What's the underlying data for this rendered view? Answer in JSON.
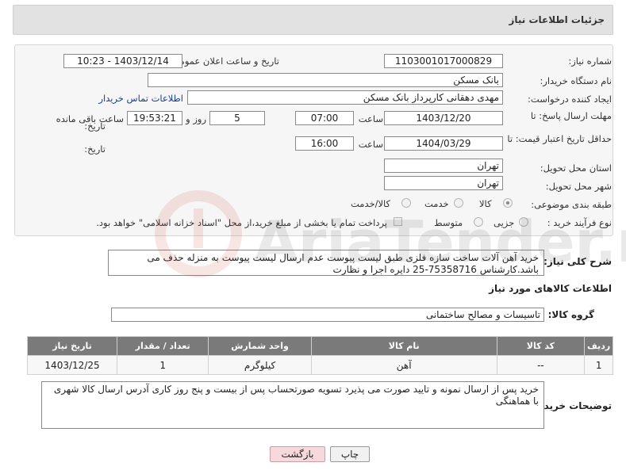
{
  "header": {
    "title": "جزئیات اطلاعات نیاز"
  },
  "form": {
    "need_number_label": "شماره نیاز:",
    "need_number": "1103001017000829",
    "announce_label": "تاریخ و ساعت اعلان عمومی:",
    "announce_value": "1403/12/14 - 10:23",
    "buyer_org_label": "نام دستگاه خریدار:",
    "buyer_org": "بانک مسکن",
    "creator_label": "ایجاد کننده درخواست:",
    "creator": "مهدی دهقانی کارپرداز بانک مسکن",
    "contact_link": "اطلاعات تماس خریدار",
    "deadline_label_1": "مهلت ارسال پاسخ: تا",
    "deadline_label_2": "تاریخ:",
    "deadline_date": "1403/12/20",
    "time_label": "ساعت",
    "deadline_time": "07:00",
    "days_value": "5",
    "days_label": "روز و",
    "remaining_time": "19:53:21",
    "remaining_label": "ساعت باقی مانده",
    "validity_label_1": "حداقل تاریخ اعتبار قیمت: تا",
    "validity_label_2": "تاریخ:",
    "validity_date": "1404/03/29",
    "validity_time_label": "ساعت",
    "validity_time": "16:00",
    "province_label": "استان محل تحویل:",
    "province": "تهران",
    "city_label": "شهر محل تحویل:",
    "city": "تهران",
    "category_label": "طبقه بندی موضوعی:",
    "category_options": [
      "کالا",
      "خدمت",
      "کالا/خدمت"
    ],
    "process_label": "نوع فرآیند خرید :",
    "process_options": [
      "جزیی",
      "متوسط"
    ],
    "payment_note": "پرداخت تمام یا بخشی از مبلغ خرید،از محل \"اسناد خزانه اسلامی\" خواهد بود."
  },
  "description": {
    "label": "شرح کلی نیاز:",
    "text": "خرید آهن آلات ساخت سازه فلزی طبق لیست پیوست عدم ارسال لیست پیوست به منزله حذف می باشد.کارشناس 75358716-25 دایره اجرا و نظارت"
  },
  "goods": {
    "section_title": "اطلاعات کالاهای مورد نیاز",
    "group_label": "گروه کالا:",
    "group_value": "تاسیسات و مصالح ساختمانی",
    "columns": [
      "ردیف",
      "کد کالا",
      "نام کالا",
      "واحد شمارش",
      "تعداد / مقدار",
      "تاریخ نیاز"
    ],
    "rows": [
      [
        "1",
        "--",
        "آهن",
        "کیلوگرم",
        "1",
        "1403/12/25"
      ]
    ]
  },
  "buyer_notes": {
    "label": "توضیحات خریدار:",
    "text": "خرید پس از ارسال نمونه و تایید صورت می پذیرد تسویه صورتحساب پس از بیست و پنج روز کاری آدرس ارسال کالا شهری با هماهنگی"
  },
  "buttons": {
    "print": "چاپ",
    "back": "بازگشت"
  },
  "watermark": {
    "text": "AriaTender.neT"
  }
}
